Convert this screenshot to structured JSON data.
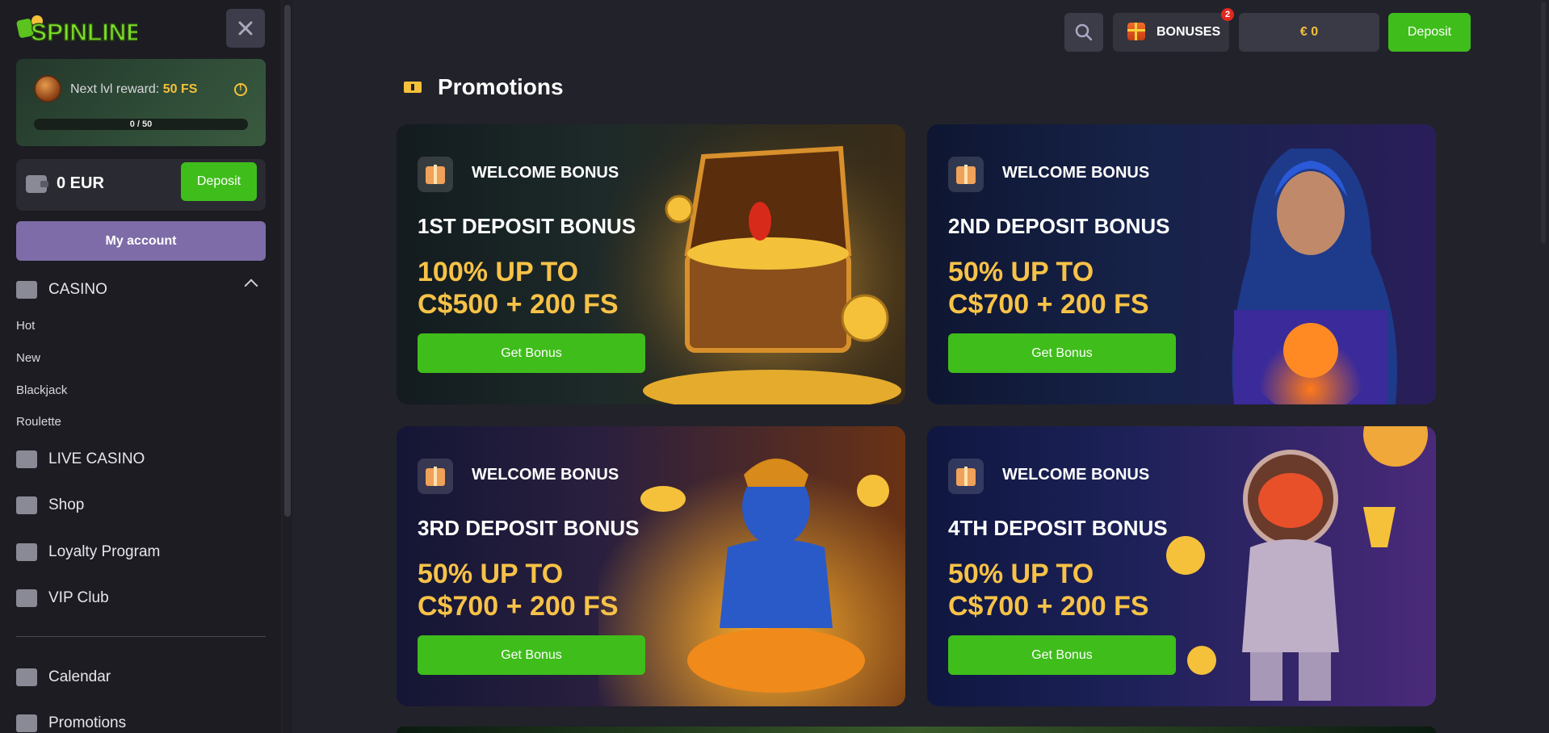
{
  "sidebar": {
    "logo_text": "SPINLINE",
    "level": {
      "label": "Next lvl reward:",
      "reward": "50 FS",
      "progress_text": "0 / 50",
      "progress_fraction": 0
    },
    "wallet": {
      "amount": "0 EUR",
      "deposit_label": "Deposit"
    },
    "account_label": "My account",
    "casino_label": "CASINO",
    "casino_sub": [
      "Hot",
      "New",
      "Blackjack",
      "Roulette"
    ],
    "nav": [
      "LIVE CASINO",
      "Shop",
      "Loyalty Program",
      "VIP Club"
    ],
    "bottom_nav": [
      "Calendar",
      "Promotions"
    ]
  },
  "header": {
    "bonuses_label": "BONUSES",
    "bonuses_badge": "2",
    "balance": "€ 0",
    "deposit_label": "Deposit"
  },
  "page": {
    "title": "Promotions"
  },
  "promos": [
    {
      "label": "WELCOME BONUS",
      "title": "1ST DEPOSIT BONUS",
      "offer_line1": "100% UP TO",
      "offer_line2": "C$500 + 200 FS",
      "button": "Get Bonus"
    },
    {
      "label": "WELCOME BONUS",
      "title": "2ND DEPOSIT BONUS",
      "offer_line1": "50% UP TO",
      "offer_line2": "C$700 + 200 FS",
      "button": "Get Bonus"
    },
    {
      "label": "WELCOME BONUS",
      "title": "3RD DEPOSIT BONUS",
      "offer_line1": "50% UP TO",
      "offer_line2": "C$700 + 200 FS",
      "button": "Get Bonus"
    },
    {
      "label": "WELCOME BONUS",
      "title": "4TH DEPOSIT BONUS",
      "offer_line1": "50% UP TO",
      "offer_line2": "C$700 + 200 FS",
      "button": "Get Bonus"
    }
  ],
  "colors": {
    "accent_green": "#3fbd1b",
    "accent_yellow": "#f7c247",
    "account_purple": "#7e6ca8",
    "bg": "#22222a",
    "sidebar_bg": "#1c1c22"
  },
  "icons": [
    "close-icon",
    "info-icon",
    "wallet-icon",
    "casino-icon",
    "chevron-up-icon",
    "live-casino-icon",
    "shop-icon",
    "loyalty-icon",
    "vip-crown-icon",
    "calendar-icon",
    "promotions-ticket-icon",
    "search-icon",
    "gift-icon"
  ]
}
